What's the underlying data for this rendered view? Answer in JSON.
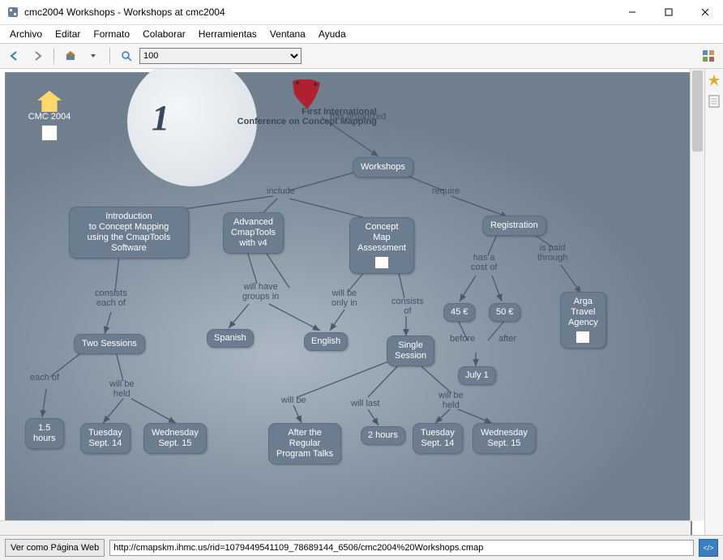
{
  "window": {
    "title": "cmc2004 Workshops - Workshops at cmc2004"
  },
  "menu": {
    "items": [
      "Archivo",
      "Editar",
      "Formato",
      "Colaborar",
      "Herramientas",
      "Ventana",
      "Ayuda"
    ]
  },
  "toolbar": {
    "zoom": "100"
  },
  "home": {
    "label": "CMC 2004"
  },
  "header": {
    "line1": "First International",
    "line2": "Conference on Concept Mapping"
  },
  "nodes": {
    "workshops": "Workshops",
    "intro": "Introduction\nto Concept Mapping\nusing the CmapTools\nSoftware",
    "advanced": "Advanced\nCmapTools\nwith v4",
    "assessment": "Concept\nMap\nAssessment",
    "registration": "Registration",
    "two_sessions": "Two Sessions",
    "spanish": "Spanish",
    "english": "English",
    "single_session": "Single\nSession",
    "cost45": "45 €",
    "cost50": "50 €",
    "arga": "Arga\nTravel\nAgency",
    "july1": "July 1",
    "hours15": "1.5\nhours",
    "tue14a": "Tuesday\nSept. 14",
    "wed15a": "Wednesday\nSept. 15",
    "after_talks": "After the\nRegular\nProgram Talks",
    "hours2": "2 hours",
    "tue14b": "Tuesday\nSept. 14",
    "wed15b": "Wednesday\nSept. 15"
  },
  "links": {
    "has_organized": "has organized",
    "include": "include",
    "require": "require",
    "consists_each_of": "consists\neach of",
    "will_have_groups_in": "will have\ngroups in",
    "will_be_only_in": "will be\nonly in",
    "consists_of": "consists\nof",
    "has_cost_of": "has a\ncost of",
    "is_paid_through": "is paid\nthrough",
    "each_of": "each of",
    "will_be_held_a": "will be\nheld",
    "will_be": "will be",
    "will_last": "will last",
    "will_be_held_b": "will be\nheld",
    "before": "before",
    "after": "after"
  },
  "status": {
    "button": "Ver como Página Web",
    "url": "http://cmapskm.ihmc.us/rid=1079449541109_78689144_6506/cmc2004%20Workshops.cmap"
  }
}
